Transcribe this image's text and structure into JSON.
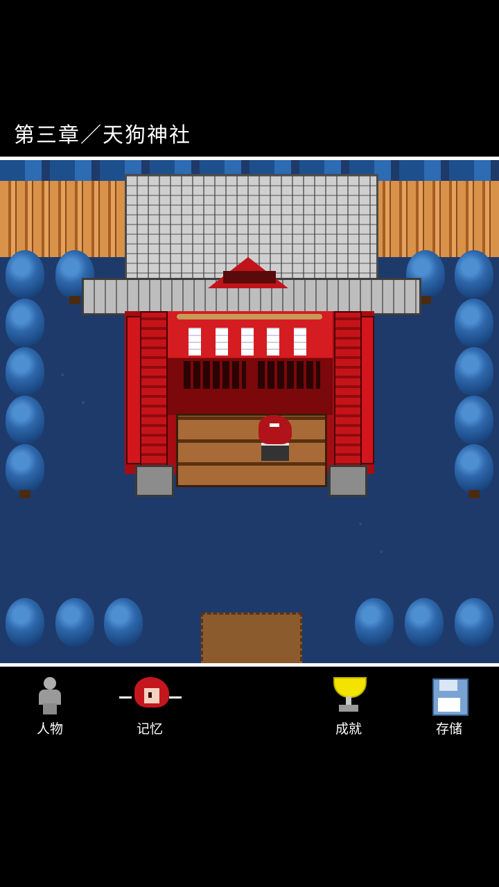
{
  "chapter": {
    "title": "第三章／天狗神社"
  },
  "menu": {
    "items": [
      {
        "label": "人物",
        "icon": "person-icon"
      },
      {
        "label": "记忆",
        "icon": "memory-portrait-icon"
      },
      {
        "label": "成就",
        "icon": "trophy-icon"
      },
      {
        "label": "存储",
        "icon": "save-disk-icon"
      }
    ]
  },
  "colors": {
    "background": "#000000",
    "ground": "#1e3a6b",
    "shrine_red": "#c4141a",
    "trophy_yellow": "#f2e300",
    "divider": "#ffffff"
  }
}
